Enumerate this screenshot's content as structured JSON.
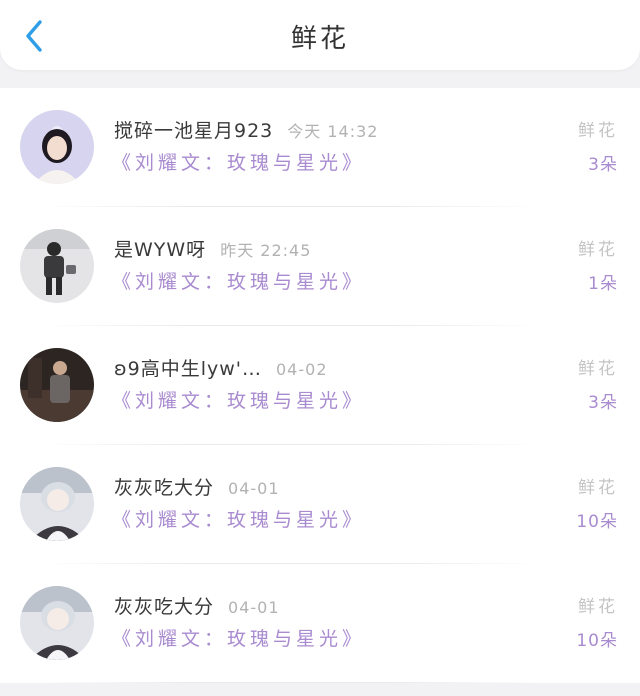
{
  "header": {
    "title": "鲜花"
  },
  "colors": {
    "accent_back": "#2f9ee8",
    "song_purple": "#a98bd0",
    "muted_gray": "#b2b2b2"
  },
  "records": [
    {
      "user": "搅碎一池星月923",
      "time": "今天 14:32",
      "song": "《刘耀文：玫瑰与星光》",
      "gift": "鲜花",
      "count": "3朵"
    },
    {
      "user": "是WYW呀",
      "time": "昨天 22:45",
      "song": "《刘耀文：玫瑰与星光》",
      "gift": "鲜花",
      "count": "1朵"
    },
    {
      "user": "ʚ9高中生lyw'…",
      "time": "04-02",
      "song": "《刘耀文：玫瑰与星光》",
      "gift": "鲜花",
      "count": "3朵"
    },
    {
      "user": "灰灰吃大分",
      "time": "04-01",
      "song": "《刘耀文：玫瑰与星光》",
      "gift": "鲜花",
      "count": "10朵"
    },
    {
      "user": "灰灰吃大分",
      "time": "04-01",
      "song": "《刘耀文：玫瑰与星光》",
      "gift": "鲜花",
      "count": "10朵"
    }
  ]
}
